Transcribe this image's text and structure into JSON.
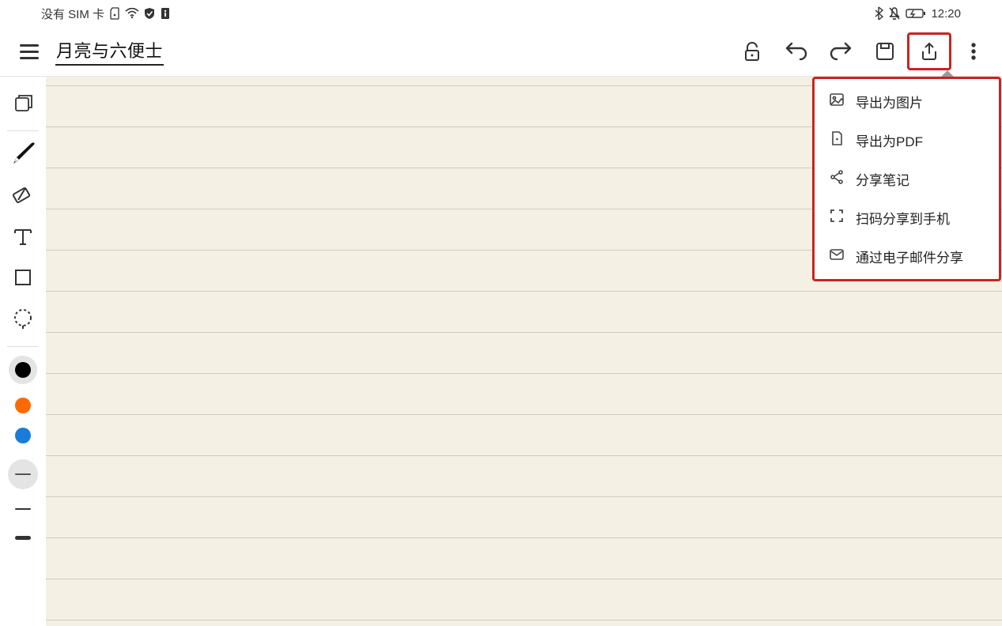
{
  "status": {
    "sim_text": "没有 SIM 卡",
    "time": "12:20"
  },
  "header": {
    "title": "月亮与六便士"
  },
  "share_menu": {
    "items": [
      {
        "label": "导出为图片"
      },
      {
        "label": "导出为PDF"
      },
      {
        "label": "分享笔记"
      },
      {
        "label": "扫码分享到手机"
      },
      {
        "label": "通过电子邮件分享"
      }
    ]
  },
  "colors": {
    "black": "#000000",
    "orange": "#ff6a00",
    "blue": "#1b7bd8",
    "gray_sel_bg": "#e4e4e4"
  }
}
